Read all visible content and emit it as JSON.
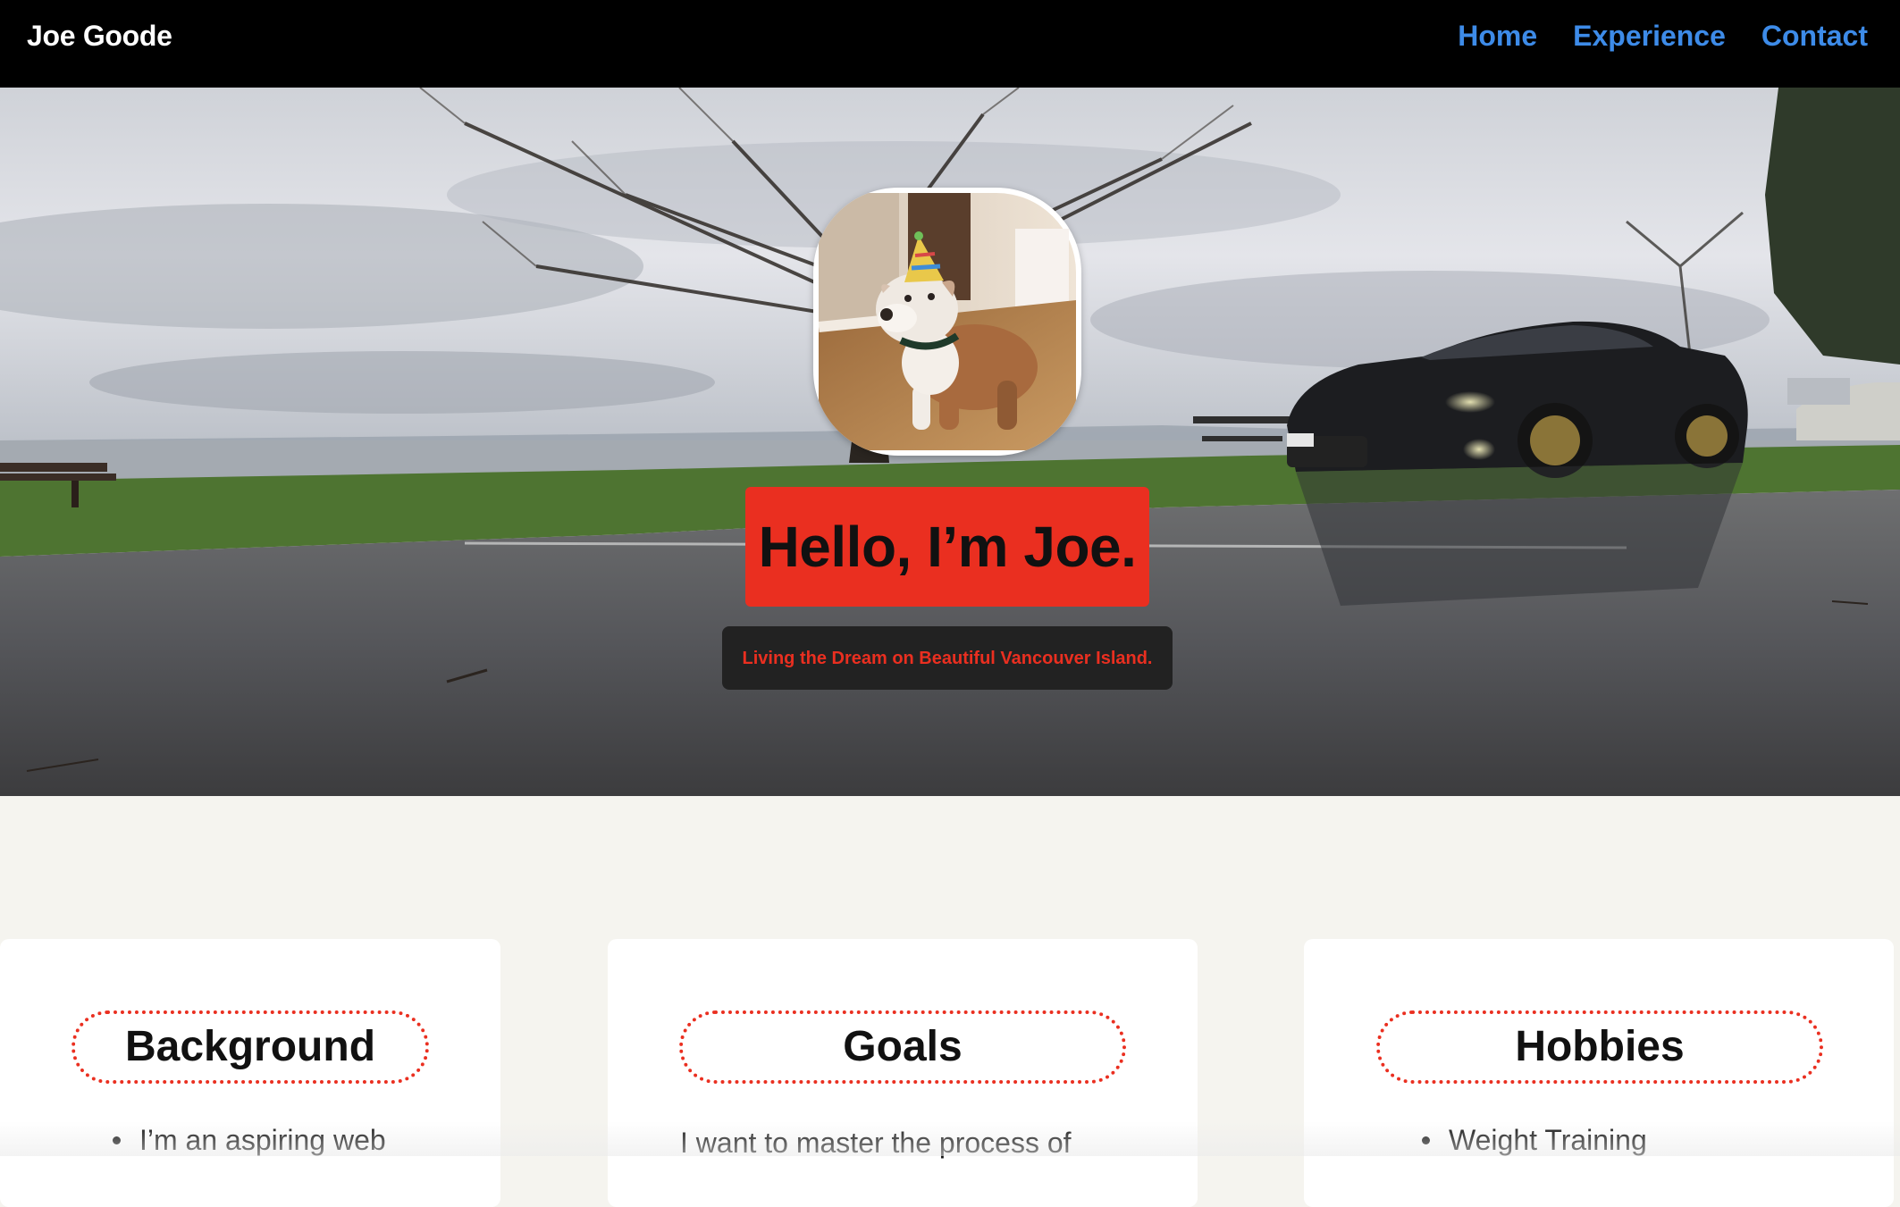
{
  "nav": {
    "brand": "Joe Goode",
    "links": [
      {
        "label": "Home"
      },
      {
        "label": "Experience"
      },
      {
        "label": "Contact"
      }
    ]
  },
  "hero": {
    "headline": "Hello, I’m Joe.",
    "tagline": "Living the Dream on Beautiful Vancouver Island."
  },
  "cards": {
    "background": {
      "title": "Background",
      "items": [
        "I’m an aspiring web"
      ]
    },
    "goals": {
      "title": "Goals",
      "text": "I want to master the process of"
    },
    "hobbies": {
      "title": "Hobbies",
      "items": [
        "Weight Training"
      ]
    }
  },
  "colors": {
    "nav_bg": "#000000",
    "nav_link": "#3d8be8",
    "accent_red": "#ea2f20",
    "tagline_bg": "#222222",
    "page_bg": "#f5f4ef"
  },
  "icons": {
    "avatar": "dog-portrait-image",
    "hero_background": "waterfront-parking-lot-photo"
  }
}
